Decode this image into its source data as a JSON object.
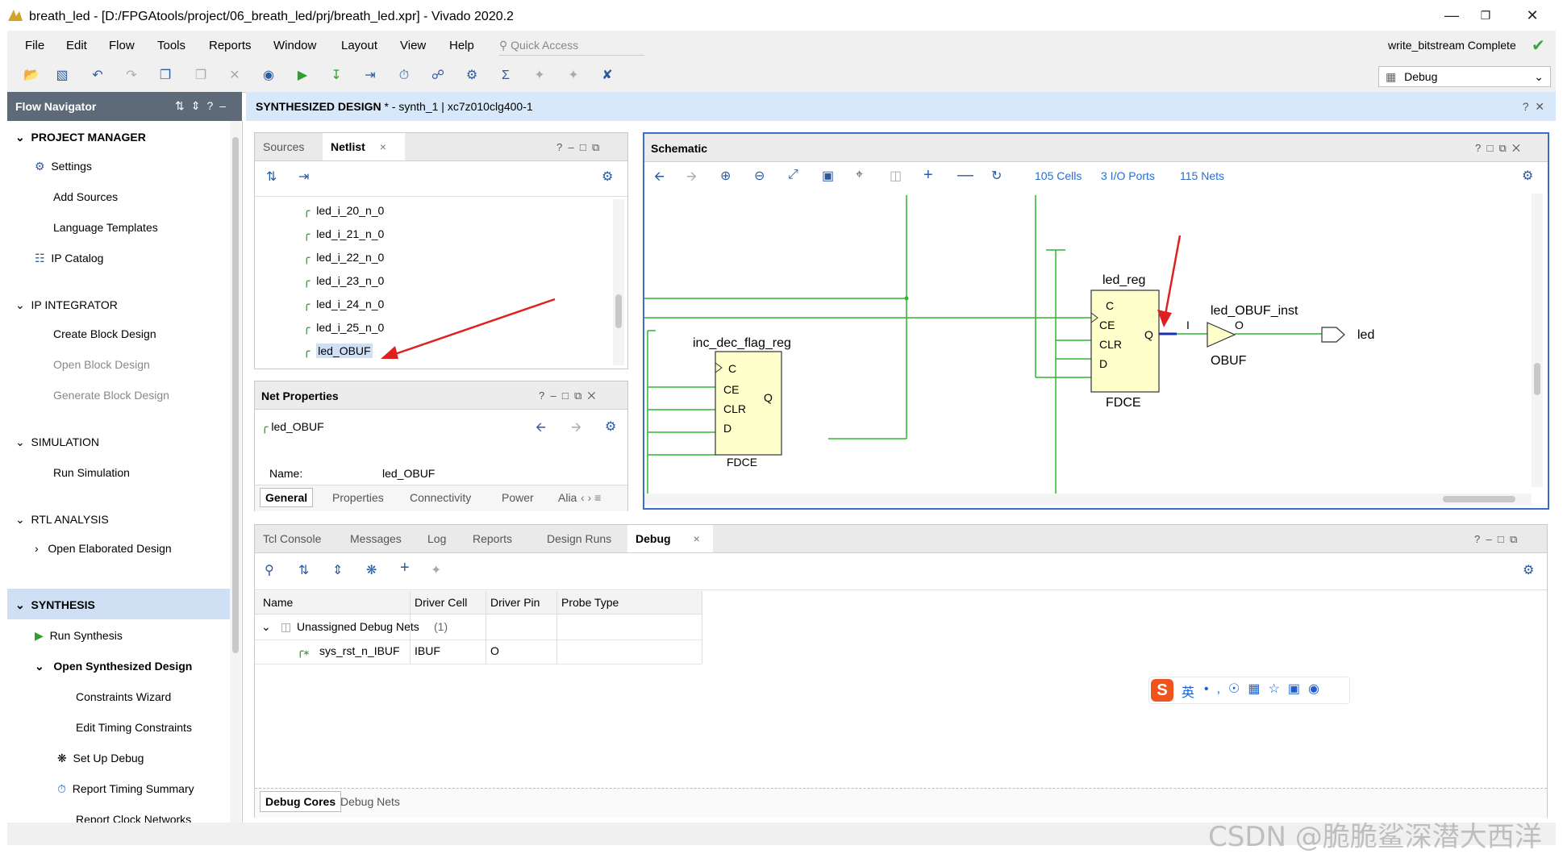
{
  "window": {
    "title": "breath_led - [D:/FPGAtools/project/06_breath_led/prj/breath_led.xpr] - Vivado 2020.2",
    "min": "—",
    "max": "❐",
    "close": "✕"
  },
  "menu": [
    "File",
    "Edit",
    "Flow",
    "Tools",
    "Reports",
    "Window",
    "Layout",
    "View",
    "Help"
  ],
  "quick_access": "Quick Access",
  "status": "write_bitstream Complete",
  "layout_select": "Debug",
  "flow_nav": {
    "title": "Flow Navigator",
    "project_manager": "PROJECT MANAGER",
    "settings": "Settings",
    "add_sources": "Add Sources",
    "language_templates": "Language Templates",
    "ip_catalog": "IP Catalog",
    "ip_integrator": "IP INTEGRATOR",
    "create_block": "Create Block Design",
    "open_block": "Open Block Design",
    "generate_block": "Generate Block Design",
    "simulation": "SIMULATION",
    "run_sim": "Run Simulation",
    "rtl": "RTL ANALYSIS",
    "open_elab": "Open Elaborated Design",
    "synthesis": "SYNTHESIS",
    "run_synth": "Run Synthesis",
    "open_synth": "Open Synthesized Design",
    "constraints": "Constraints Wizard",
    "edit_timing": "Edit Timing Constraints",
    "setup_debug": "Set Up Debug",
    "report_timing": "Report Timing Summary",
    "report_clock": "Report Clock Networks"
  },
  "synth_header": {
    "title": "SYNTHESIZED DESIGN",
    "sub": " * - synth_1 | xc7z010clg400-1"
  },
  "netlist": {
    "tabs": [
      "Sources",
      "Netlist"
    ],
    "items": [
      "led_i_20_n_0",
      "led_i_21_n_0",
      "led_i_22_n_0",
      "led_i_23_n_0",
      "led_i_24_n_0",
      "led_i_25_n_0",
      "led_OBUF"
    ]
  },
  "netprops": {
    "title": "Net Properties",
    "net": "led_OBUF",
    "name_label": "Name:",
    "name_value": "led_OBUF",
    "tabs": [
      "General",
      "Properties",
      "Connectivity",
      "Power",
      "Alia"
    ]
  },
  "schematic": {
    "title": "Schematic",
    "cells": "105 Cells",
    "ports": "3 I/O Ports",
    "nets": "115 Nets",
    "ff1": {
      "name": "inc_dec_flag_reg",
      "type": "FDCE",
      "pins": [
        "C",
        "CE",
        "CLR",
        "D"
      ],
      "out": "Q"
    },
    "ff2": {
      "name": "led_reg",
      "type": "FDCE",
      "pins": [
        "C",
        "CE",
        "CLR",
        "D"
      ],
      "out": "Q"
    },
    "buf": {
      "name": "led_OBUF_inst",
      "type": "OBUF",
      "in": "I",
      "out": "O"
    },
    "port": "led"
  },
  "bottom": {
    "tabs": [
      "Tcl Console",
      "Messages",
      "Log",
      "Reports",
      "Design Runs",
      "Debug"
    ],
    "columns": [
      "Name",
      "Driver Cell",
      "Driver Pin",
      "Probe Type"
    ],
    "group": "Unassigned Debug Nets",
    "group_count": "(1)",
    "row": [
      "sys_rst_n_IBUF",
      "IBUF",
      "O",
      ""
    ],
    "subtabs": [
      "Debug Cores",
      "Debug Nets"
    ]
  },
  "ime": {
    "lang": "英"
  },
  "watermark": "CSDN @脆脆鲨深潜大西洋",
  "colors": {
    "accent": "#2a6fd0",
    "nav_head": "#5e6a78",
    "synth_head": "#d7e8fb",
    "wire": "#2fb52f",
    "highlight_wire": "#1a2fb0",
    "cell_fill": "#ffffcc",
    "arrow": "#e02020"
  }
}
